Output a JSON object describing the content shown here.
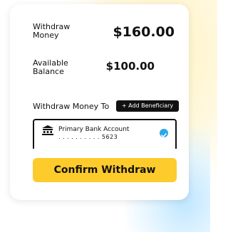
{
  "withdraw": {
    "label": "Withdraw Money",
    "amount": "$160.00"
  },
  "balance": {
    "label": "Available Balance",
    "amount": "$100.00"
  },
  "destination": {
    "section_label": "Withdraw Money To",
    "add_button_label": "+ Add Beneficiary",
    "account_name": "Primary Bank Account",
    "account_number": ". . . . . . . . . . 5623",
    "selected": true,
    "icon": "bank-icon"
  },
  "confirm_label": "Confirm Withdraw",
  "colors": {
    "accent": "#fdcb2c",
    "check": "#2aa8e8",
    "dark": "#111111"
  }
}
